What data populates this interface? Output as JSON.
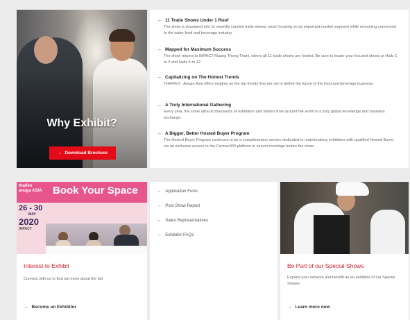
{
  "hero": {
    "title": "Why Exhibit?",
    "button_label": "Download Brochure",
    "button_icon": "arrow-right-icon"
  },
  "features": [
    {
      "title": "11 Trade Shows Under 1 Roof",
      "desc": "The show is structured into 11 expertly curated trade shows, each focusing on an important market segment while remaining connected to the wider food and beverage industry."
    },
    {
      "title": "Mapped for Maximum Success",
      "desc": "The show returns to IMPACT Muang Thong Thani, where all 11 trade shows are hosted. Be sure to locate your focused shows at Halls 1 to 3 and Halls 5 to 12."
    },
    {
      "title": "Capitalizing on The Hottest Trends",
      "desc": "THAIFEX - Anuga Asia offers insights on the top trends that are set to define the future of the food and beverage business."
    },
    {
      "title": "A Truly International Gathering",
      "desc": "Every year, the show attracts thousands of exhibitors and visitors from around the world in a truly global knowledge and business exchange."
    },
    {
      "title": "A Bigger, Better Hosted Buyer Program",
      "desc": "The Hosted Buyer Program continues to be a complimentary service dedicated to matchmaking exhibitors with qualified Hosted Buyer, via an exclusive access to the Connex360 platform to secure meetings before the show."
    }
  ],
  "book_card": {
    "banner_text": "Book Your Space",
    "logo_text": "thaifex anuga ASIA",
    "dates_days": "26 - 30",
    "dates_month": "MAY",
    "dates_year": "2020",
    "venue": "IMPACT",
    "title": "Interest to Exhibit",
    "desc": "Connect with us to find out more about the fair",
    "link": "Become an Exhibitor"
  },
  "links_card": {
    "items": [
      "Application Form",
      "Post Show Report",
      "Sales Representatives",
      "Exhibitor FAQs"
    ]
  },
  "special_card": {
    "title": "Be Part of our Special Shows",
    "desc": "Expand your network and benefit as an exhibitor of our Special Shows!",
    "link": "Learn more now"
  },
  "colors": {
    "accent": "#e30b17",
    "title_red": "#d21f2b",
    "pink": "#e7558c",
    "background": "#ececec"
  }
}
